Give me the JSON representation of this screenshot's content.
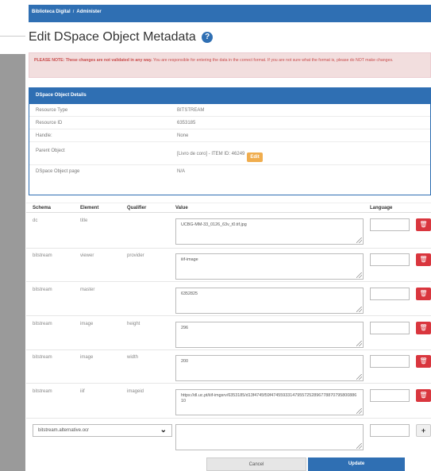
{
  "breadcrumb": {
    "home": "Biblioteca Digital",
    "sep": "/",
    "current": "Administer"
  },
  "page": {
    "title": "Edit DSpace Object Metadata",
    "help_icon": "?"
  },
  "alert": {
    "strong": "PLEASE NOTE: These changes are not validated in any way.",
    "text": " You are responsible for entering the data in the correct format. If you are not sure what the format is, please do NOT make changes."
  },
  "details": {
    "header": "DSpace Object Details",
    "rows": [
      {
        "label": "Resource Type",
        "value": "BITSTREAM"
      },
      {
        "label": "Resource ID",
        "value": "6353185"
      },
      {
        "label": "Handle:",
        "value": "None"
      },
      {
        "label": "Parent Object",
        "value": "[Livro de coro] - ITEM ID: 46249"
      },
      {
        "label": "DSpace Object page",
        "value": "N/A"
      }
    ],
    "edit_label": "Edit"
  },
  "table": {
    "headers": {
      "schema": "Schema",
      "element": "Element",
      "qualifier": "Qualifier",
      "value": "Value",
      "language": "Language"
    },
    "rows": [
      {
        "schema": "dc",
        "element": "title",
        "qualifier": "",
        "value": "UCBG-MM-33_0126_63v_t0.tif.jpg"
      },
      {
        "schema": "bitstream",
        "element": "viewer",
        "qualifier": "provider",
        "value": "iiif-image"
      },
      {
        "schema": "bitstream",
        "element": "master",
        "qualifier": "",
        "value": "6352825"
      },
      {
        "schema": "bitstream",
        "element": "image",
        "qualifier": "height",
        "value": "296"
      },
      {
        "schema": "bitstream",
        "element": "image",
        "qualifier": "width",
        "value": "200"
      },
      {
        "schema": "bitstream",
        "element": "iiif",
        "qualifier": "imageid",
        "value": "https://dl.uc.pt/iiif-imgsrv/6353185/d13f4745f59f4745593314795572528967788707958008861​0"
      }
    ],
    "new_field_select": "bitstream.alternative.ocr",
    "delete_icon": "trash-icon",
    "add_icon": "plus-icon"
  },
  "buttons": {
    "cancel": "Cancel",
    "update": "Update"
  },
  "colors": {
    "primary": "#2f6fb3",
    "danger": "#d9363e",
    "warning": "#f0ad4e",
    "alert_bg": "#f2dede"
  }
}
